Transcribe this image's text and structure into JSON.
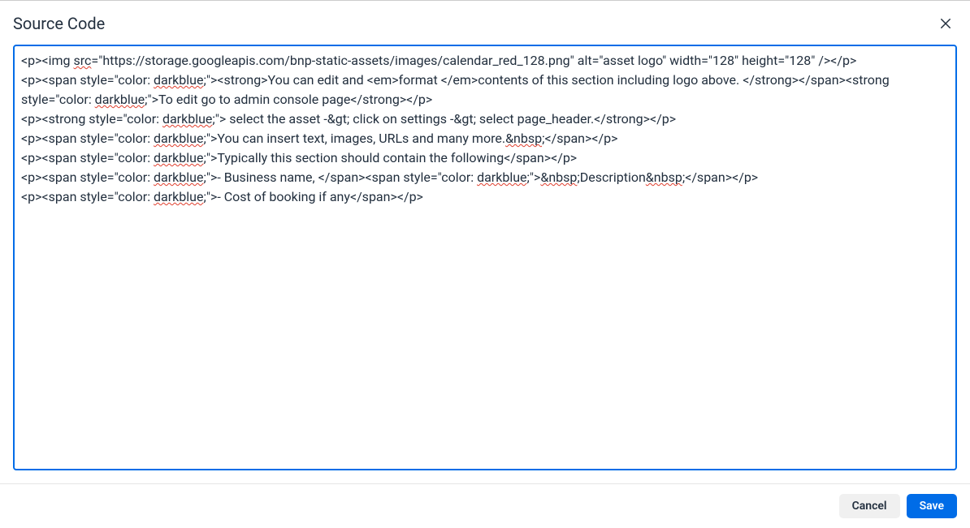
{
  "dialog": {
    "title": "Source Code",
    "close_label": "Close"
  },
  "editor": {
    "lines": [
      [
        {
          "t": "<p><img "
        },
        {
          "t": "src",
          "spell": true
        },
        {
          "t": "=\"https://storage.googleapis.com/bnp-static-assets/images/calendar_red_128.png\" alt=\"asset logo\" width=\"128\" height=\"128\" /></p>"
        }
      ],
      [
        {
          "t": "<p><span style=\"color: "
        },
        {
          "t": "darkblue",
          "spell": true
        },
        {
          "t": ";\"><strong>You can edit and <em>format </em>contents of this section including logo above. </strong></span><strong style=\"color: "
        },
        {
          "t": "darkblue",
          "spell": true
        },
        {
          "t": ";\">To edit go to admin console page</strong></p>"
        }
      ],
      [
        {
          "t": "<p><strong style=\"color: "
        },
        {
          "t": "darkblue",
          "spell": true
        },
        {
          "t": ";\"> select the asset -&gt; click on settings -&gt; select page_header.</strong></p>"
        }
      ],
      [
        {
          "t": "<p><span style=\"color: "
        },
        {
          "t": "darkblue",
          "spell": true
        },
        {
          "t": ";\">You can insert text, images, URLs and many more."
        },
        {
          "t": "&nbsp",
          "spell": true
        },
        {
          "t": ";</span></p>"
        }
      ],
      [
        {
          "t": "<p><span style=\"color: "
        },
        {
          "t": "darkblue",
          "spell": true
        },
        {
          "t": ";\">Typically this section should contain the following</span></p>"
        }
      ],
      [
        {
          "t": "<p><span style=\"color: "
        },
        {
          "t": "darkblue",
          "spell": true
        },
        {
          "t": ";\">- Business name, </span><span style=\"color: "
        },
        {
          "t": "darkblue",
          "spell": true
        },
        {
          "t": ";\">"
        },
        {
          "t": "&nbsp",
          "spell": true
        },
        {
          "t": ";Description"
        },
        {
          "t": "&nbsp",
          "spell": true
        },
        {
          "t": ";</span></p>"
        }
      ],
      [
        {
          "t": "<p><span style=\"color: "
        },
        {
          "t": "darkblue",
          "spell": true
        },
        {
          "t": ";\">- Cost of booking if any</span></p>"
        }
      ]
    ]
  },
  "footer": {
    "cancel_label": "Cancel",
    "save_label": "Save"
  }
}
